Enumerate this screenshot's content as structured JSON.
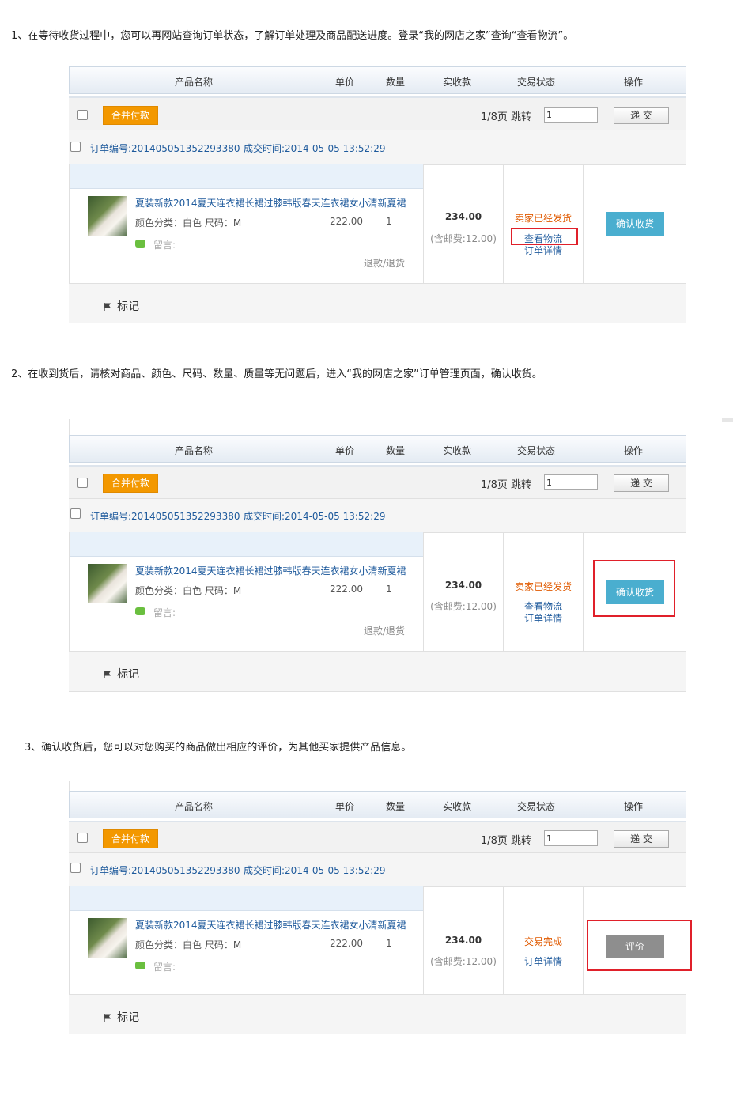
{
  "steps": [
    "1、在等待收货过程中，您可以再网站查询订单状态，了解订单处理及商品配送进度。登录“我的网店之家”查询“查看物流”。",
    "2、在收到货后，请核对商品、颜色、尺码、数量、质量等无问题后，进入“我的网店之家”订单管理页面，确认收货。",
    "3、确认收货后，您可以对您购买的商品做出相应的评价，为其他买家提供产品信息。"
  ],
  "table": {
    "headers": [
      "产品名称",
      "单价",
      "数量",
      "实收款",
      "交易状态",
      "操作"
    ],
    "merge_pay": "合并付款",
    "pager": "1/8页 跳转",
    "jump_value": "1",
    "submit": "递 交",
    "order_no": "订单编号:201405051352293380",
    "deal_time": "成交时间:2014-05-05 13:52:29",
    "product_title": "夏装新款2014夏天连衣裙长裙过膝韩版春天连衣裙女小清新夏裙",
    "attrs": "颜色分类：白色  尺码：M",
    "price": "222.00",
    "qty": "1",
    "memo": "留言:",
    "refund": "退款/退货",
    "amount": "234.00",
    "shipping": "(含邮费:12.00)",
    "mark": "标记"
  },
  "panel1": {
    "status": "卖家已经发货",
    "link1": "查看物流",
    "link2": "订单详情",
    "action": "确认收货"
  },
  "panel2": {
    "status": "卖家已经发货",
    "link1": "查看物流",
    "link2": "订单详情",
    "action": "确认收货"
  },
  "panel3": {
    "status": "交易完成",
    "link2": "订单详情",
    "action": "评价"
  },
  "colors": {
    "highlight": "#e0202a",
    "confirm_button": "#4aaecf",
    "review_button": "#8e8e8e",
    "merge_button": "#f39800",
    "status": "#e05a00",
    "link": "#1e5a9c"
  }
}
